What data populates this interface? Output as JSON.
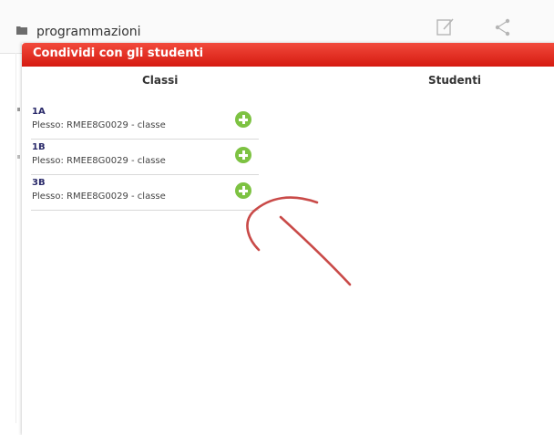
{
  "background": {
    "title": "programmazioni",
    "icons": [
      "folder-icon",
      "edit-icon",
      "share-icon"
    ]
  },
  "modal": {
    "title": "Condividi con gli studenti",
    "header_color": "#e42a1f",
    "columns": {
      "classi": "Classi",
      "studenti": "Studenti"
    },
    "classes": [
      {
        "name": "1A",
        "subtitle": "Plesso: RMEE8G0029 - classe"
      },
      {
        "name": "1B",
        "subtitle": "Plesso: RMEE8G0029 - classe"
      },
      {
        "name": "3B",
        "subtitle": "Plesso: RMEE8G0029 - classe"
      }
    ],
    "add_icon": "plus-circle-icon",
    "add_color": "#7dc242"
  },
  "annotation": {
    "type": "hand-drawn-arrow",
    "color": "#c94a48"
  }
}
